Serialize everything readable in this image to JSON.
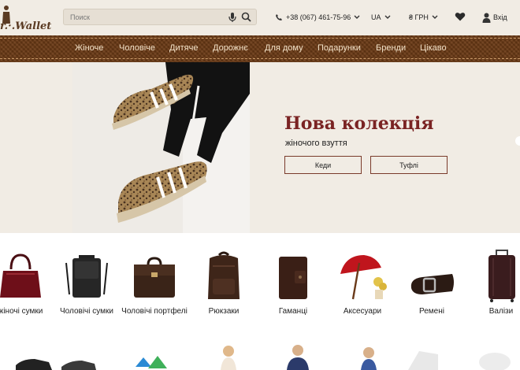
{
  "header": {
    "logo_text": "r.·.Wallet",
    "search_placeholder": "Поиск",
    "phone": "+38 (067) 461-75-96",
    "language": "UA",
    "currency": "₴ ГРН",
    "login_label": "Вхід",
    "icons": [
      "mic-icon",
      "search-icon",
      "phone-icon",
      "chevron-down-icon",
      "heart-icon",
      "user-icon"
    ]
  },
  "nav": {
    "items": [
      "Жіноче",
      "Чоловіче",
      "Дитяче",
      "Дорожнє",
      "Для дому",
      "Подарунки",
      "Бренди",
      "Цікаво"
    ]
  },
  "hero": {
    "title": "Нова колекція",
    "subtitle": "жіночого взуття",
    "buttons": [
      "Кеди",
      "Туфлі"
    ]
  },
  "categories": [
    {
      "label": "жіночі сумки",
      "icon": "handbag-icon"
    },
    {
      "label": "Чоловічі сумки",
      "icon": "messenger-bag-icon"
    },
    {
      "label": "Чоловічі портфелі",
      "icon": "briefcase-icon"
    },
    {
      "label": "Рюкзаки",
      "icon": "backpack-icon"
    },
    {
      "label": "Гаманці",
      "icon": "wallet-icon"
    },
    {
      "label": "Аксесуари",
      "icon": "umbrella-icon"
    },
    {
      "label": "Ремені",
      "icon": "belt-icon"
    },
    {
      "label": "Валізи",
      "icon": "suitcase-icon"
    }
  ],
  "colors": {
    "nav_bg": "#6b3a15",
    "nav_text": "#f3e2c8",
    "title_red": "#7a2323",
    "page_bg": "#f1ece4"
  }
}
